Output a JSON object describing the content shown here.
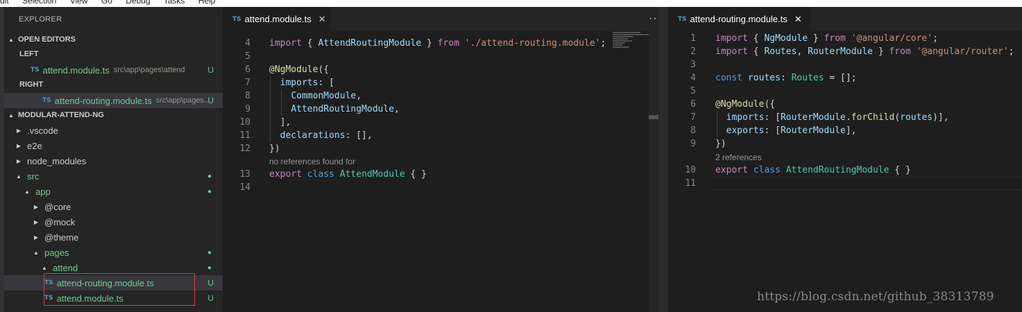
{
  "menubar": {
    "items": [
      "dit",
      "Selection",
      "View",
      "Go",
      "Debug",
      "Tasks",
      "Help"
    ]
  },
  "sidebar": {
    "title": "EXPLORER",
    "open_editors": {
      "header": "OPEN EDITORS",
      "groups": [
        {
          "label": "LEFT",
          "file": "attend.module.ts",
          "path": "src\\app\\pages\\attend",
          "status": "U"
        },
        {
          "label": "RIGHT",
          "file": "attend-routing.module.ts",
          "path": "src\\app\\pages...",
          "status": "U"
        }
      ]
    },
    "project": {
      "header": "MODULAR-ATTEND-NG",
      "rows": [
        {
          "name": ".vscode"
        },
        {
          "name": "e2e"
        },
        {
          "name": "node_modules"
        },
        {
          "name": "src",
          "badge": "●"
        },
        {
          "name": "app",
          "badge": "●"
        },
        {
          "name": "@core"
        },
        {
          "name": "@mock"
        },
        {
          "name": "@theme"
        },
        {
          "name": "pages",
          "badge": "●"
        },
        {
          "name": "attend",
          "badge": "●"
        },
        {
          "name": "attend-routing.module.ts",
          "status": "U"
        },
        {
          "name": "attend.module.ts",
          "status": "U"
        }
      ]
    },
    "file_icon_label": "TS"
  },
  "left_editor": {
    "tab": {
      "icon": "TS",
      "label": "attend.module.ts",
      "close": "✕"
    },
    "more": "···",
    "line_numbers": [
      "4",
      "5",
      "6",
      "7",
      "8",
      "9",
      "10",
      "11",
      "12",
      "13",
      "14"
    ],
    "codelens": "no references found for"
  },
  "right_editor": {
    "tab": {
      "icon": "TS",
      "label": "attend-routing.module.ts",
      "close": "✕"
    },
    "line_numbers": [
      "1",
      "2",
      "3",
      "4",
      "5",
      "6",
      "7",
      "8",
      "9",
      "10",
      "11"
    ],
    "codelens": "2 references"
  },
  "code_text": {
    "import": "import",
    "from": "from",
    "export": "export",
    "class": "class",
    "const": "const",
    "AttendRoutingModule": "AttendRoutingModule",
    "attend_routing_path": "'./attend-routing.module'",
    "NgModule_dec": "@NgModule",
    "imports": "imports",
    "declarations": "declarations",
    "exports": "exports",
    "CommonModule": "CommonModule",
    "AttendModule": "AttendModule",
    "NgModule": "NgModule",
    "angular_core": "'@angular/core'",
    "Routes": "Routes",
    "RouterModule": "RouterModule",
    "angular_router": "'@angular/router'",
    "routes": "routes",
    "forChild": "forChild"
  },
  "watermark": "https://blog.csdn.net/github_38313789"
}
